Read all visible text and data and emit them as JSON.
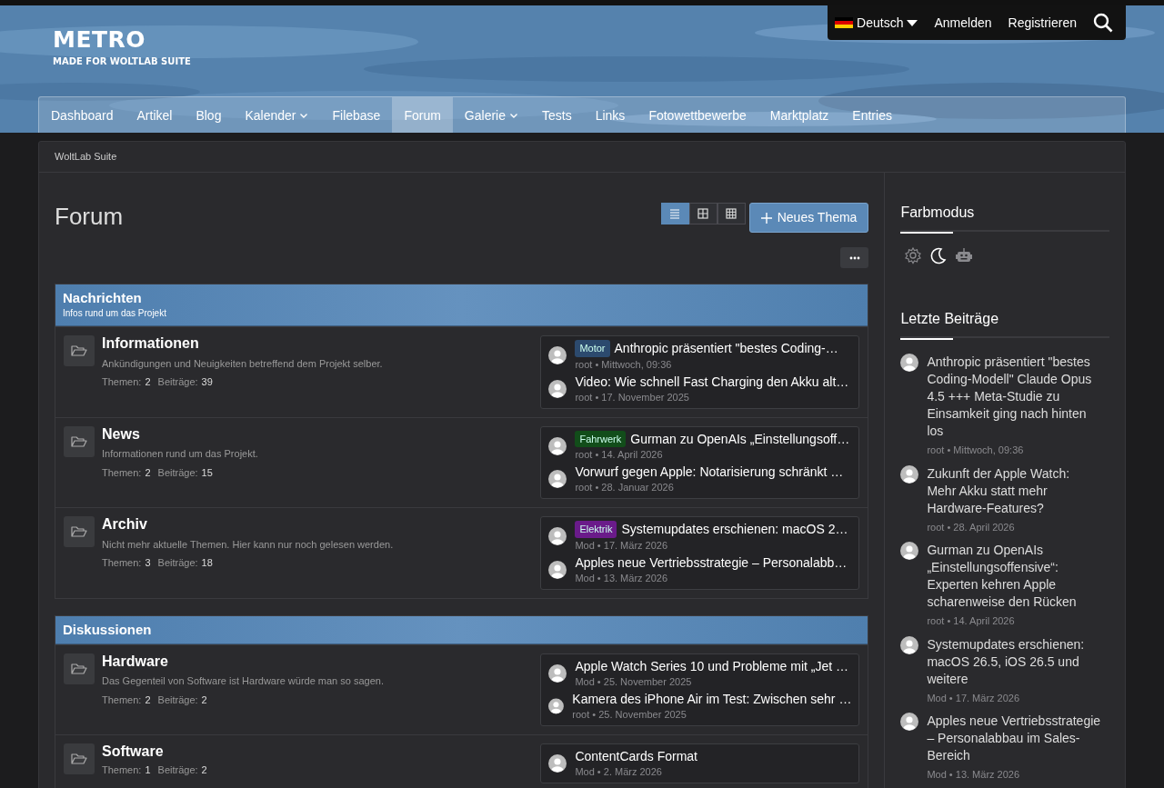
{
  "header": {
    "logo": "METRO",
    "tagline": "MADE FOR WOLTLAB SUITE"
  },
  "user_bar": {
    "language": "Deutsch",
    "links": [
      "Anmelden",
      "Registrieren"
    ]
  },
  "nav": [
    {
      "label": "Dashboard",
      "selected": false,
      "dropdown": false
    },
    {
      "label": "Artikel",
      "selected": false,
      "dropdown": false
    },
    {
      "label": "Blog",
      "selected": false,
      "dropdown": false
    },
    {
      "label": "Kalender",
      "selected": false,
      "dropdown": true
    },
    {
      "label": "Filebase",
      "selected": false,
      "dropdown": false
    },
    {
      "label": "Forum",
      "selected": true,
      "dropdown": false
    },
    {
      "label": "Galerie",
      "selected": false,
      "dropdown": true
    },
    {
      "label": "Tests",
      "selected": false,
      "dropdown": false
    },
    {
      "label": "Links",
      "selected": false,
      "dropdown": false
    },
    {
      "label": "Fotowettbewerbe",
      "selected": false,
      "dropdown": false
    },
    {
      "label": "Marktplatz",
      "selected": false,
      "dropdown": false
    },
    {
      "label": "Entries",
      "selected": false,
      "dropdown": false
    }
  ],
  "breadcrumb": [
    "WoltLab Suite"
  ],
  "page": {
    "title": "Forum",
    "view_modes": [
      {
        "kind": "list",
        "selected": true
      },
      {
        "kind": "grid",
        "selected": false
      },
      {
        "kind": "table",
        "selected": false
      }
    ],
    "new_button": "Neues Thema"
  },
  "categories": [
    {
      "title": "Nachrichten",
      "description": "Infos rund um das Projekt",
      "boards": [
        {
          "title": "Informationen",
          "description": "Ankündigungen und Neuigkeiten betreffend dem Projekt selber.",
          "topics_label": "Themen:",
          "topics": "2",
          "posts_label": "Beiträge:",
          "posts": "39",
          "last_posts": [
            {
              "label": {
                "text": "Motor",
                "color": "#2c4a6e"
              },
              "title": "Anthropic präsentiert \"bestes Coding-…",
              "meta": "root • Mittwoch, 09:36"
            },
            {
              "title": "Video: Wie schnell Fast Charging den Akku alt…",
              "meta": "root • 17. November 2025"
            }
          ]
        },
        {
          "title": "News",
          "description": "Informationen rund um das Projekt.",
          "topics_label": "Themen:",
          "topics": "2",
          "posts_label": "Beiträge:",
          "posts": "15",
          "last_posts": [
            {
              "label": {
                "text": "Fahrwerk",
                "color": "#124d1a"
              },
              "title": "Gurman zu OpenAIs „Einstellungsoff…",
              "meta": "root • 14. April 2026"
            },
            {
              "title": "Vorwurf gegen Apple: Notarisierung schränkt …",
              "meta": "root • 28. Januar 2026"
            }
          ]
        },
        {
          "title": "Archiv",
          "description": "Nicht mehr aktuelle Themen. Hier kann nur noch gelesen werden.",
          "topics_label": "Themen:",
          "topics": "3",
          "posts_label": "Beiträge:",
          "posts": "18",
          "last_posts": [
            {
              "label": {
                "text": "Elektrik",
                "color": "#6a1b8a"
              },
              "title": "Systemupdates erschienen: macOS 2…",
              "meta": "Mod • 17. März 2026"
            },
            {
              "title": "Apples neue Vertriebsstrategie – Personalabb…",
              "meta": "Mod • 13. März 2026"
            }
          ]
        }
      ]
    },
    {
      "title": "Diskussionen",
      "boards": [
        {
          "title": "Hardware",
          "description": "Das Gegenteil von Software ist Hardware würde man so sagen.",
          "topics_label": "Themen:",
          "topics": "2",
          "posts_label": "Beiträge:",
          "posts": "2",
          "last_posts": [
            {
              "title": "Apple Watch Series 10 und Probleme mit „Jet …",
              "meta": "Mod • 25. November 2025"
            },
            {
              "title": "Kamera des iPhone Air im Test: Zwischen sehr …",
              "meta": "root • 25. November 2025"
            }
          ]
        },
        {
          "title": "Software",
          "topics_label": "Themen:",
          "topics": "1",
          "posts_label": "Beiträge:",
          "posts": "2",
          "last_posts": [
            {
              "title": "ContentCards Format",
              "meta": "Mod • 2. März 2026"
            }
          ]
        }
      ]
    }
  ],
  "sidebar": {
    "color_mode": {
      "title": "Farbmodus",
      "options": [
        {
          "kind": "light",
          "selected": false
        },
        {
          "kind": "dark",
          "selected": true
        },
        {
          "kind": "system",
          "selected": false
        }
      ]
    },
    "recent": {
      "title": "Letzte Beiträge",
      "posts": [
        {
          "title": "Anthropic präsentiert \"bestes Coding-Modell\" Claude Opus 4.5 +++ Meta-Studie zu Einsamkeit ging nach hinten los",
          "meta": "root • Mittwoch, 09:36"
        },
        {
          "title": "Zukunft der Apple Watch: Mehr Akku statt mehr Hardware-Features?",
          "meta": "root • 28. April 2026"
        },
        {
          "title": "Gurman zu OpenAIs „Einstellungsoffensive“: Experten kehren Apple scharenweise den Rücken",
          "meta": "root • 14. April 2026"
        },
        {
          "title": "Systemupdates erschienen: macOS 26.5, iOS 26.5 und weitere",
          "meta": "Mod • 17. März 2026"
        },
        {
          "title": "Apples neue Vertriebsstrategie – Personalabbau im Sales-Bereich",
          "meta": "Mod • 13. März 2026"
        }
      ]
    }
  }
}
